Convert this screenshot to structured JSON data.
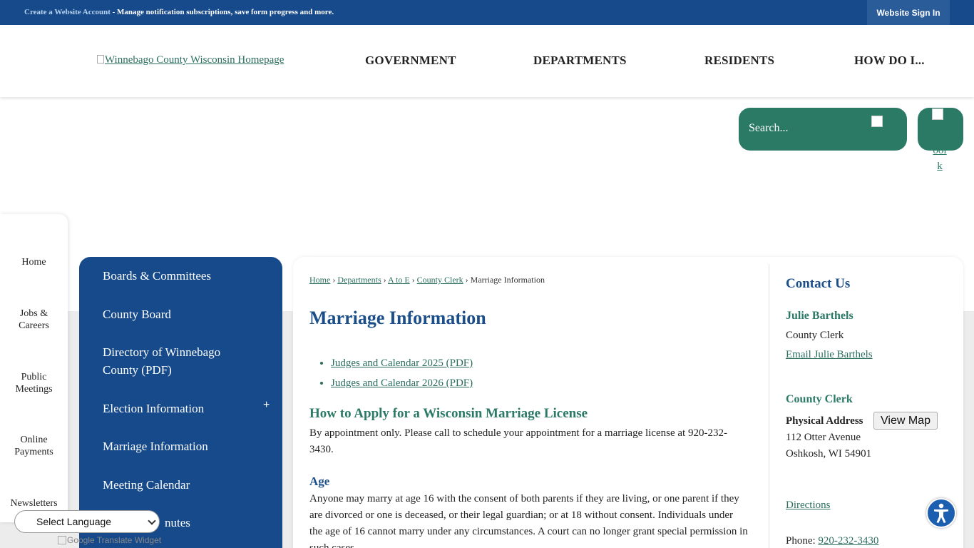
{
  "topbar": {
    "create_account": "Create a Website Account",
    "message": " - Manage notification subscriptions, save form progress and more.",
    "signin_label": "Website Sign In"
  },
  "header": {
    "logo_alt": "Winnebago County Wisconsin Homepage",
    "nav": [
      "GOVERNMENT",
      "DEPARTMENTS",
      "RESIDENTS",
      "HOW DO I..."
    ]
  },
  "search": {
    "placeholder": "Search...",
    "book_label_line1": "ool",
    "book_label_line2": "k"
  },
  "quicklinks": [
    "Home",
    "Jobs & Careers",
    "Public Meetings",
    "Online Payments",
    "Newsletters"
  ],
  "leftnav": {
    "items": [
      "Boards & Committees",
      "County Board",
      "Directory of Winnebago County (PDF)",
      "Election Information",
      "Marriage Information",
      "Meeting Calendar",
      "nutes"
    ],
    "expand_symbol": "+"
  },
  "breadcrumb": {
    "items": [
      "Home",
      "Departments",
      "A to E",
      "County Clerk"
    ],
    "separator": "›",
    "current": "Marriage Information"
  },
  "main": {
    "title": "Marriage Information",
    "docs": [
      "Judges and Calendar 2025 (PDF)",
      "Judges and Calendar 2026 (PDF)"
    ],
    "apply_heading": "How to Apply for a Wisconsin Marriage License",
    "apply_text": "By appointment only. Please call to schedule your appointment for a marriage license at 920-232-3430.",
    "age_heading": "Age",
    "age_text": "Anyone may marry at age 16 with the consent of both parents if they are living, or one parent if they are divorced or one is deceased, or their legal guardian; or at 18 without consent. Individuals under the age of 16 cannot marry under any circumstances. A court can no longer grant special permission in such cases."
  },
  "contact": {
    "title": "Contact Us",
    "name": "Julie Barthels",
    "role": "County Clerk",
    "email_label": "Email Julie Barthels",
    "dept": "County Clerk",
    "address_label": "Physical Address",
    "map_button": "View Map",
    "street": "112 Otter Avenue",
    "city": "Oshkosh, WI 54901",
    "directions": "Directions",
    "phone_label": "Phone: ",
    "phone": "920-232-3430"
  },
  "widgets": {
    "language": "Select Language",
    "google_translate": "Google Translate Widget"
  },
  "colors": {
    "primary_blue": "#164a8a",
    "accent_green": "#2b7a66"
  }
}
